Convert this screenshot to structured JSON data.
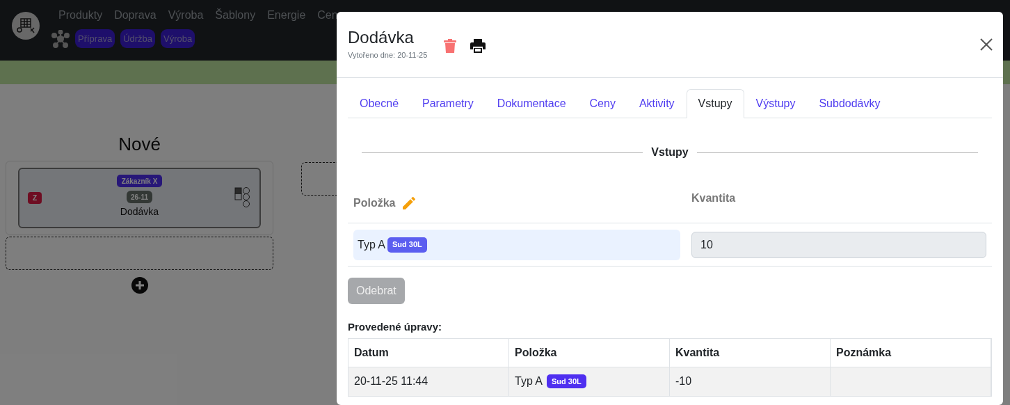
{
  "navbar": {
    "menu": [
      "Produkty",
      "Doprava",
      "Výroba",
      "Šablony",
      "Energie",
      "Cen"
    ],
    "tags": [
      "Příprava",
      "Údržba",
      "Výroba"
    ]
  },
  "board": {
    "columns": [
      {
        "title": "Nové",
        "cards": [
          {
            "badge": "Z",
            "customer": "Zákazník X",
            "date": "26-11",
            "title": "Dodávka"
          }
        ]
      }
    ]
  },
  "modal": {
    "title": "Dodávka",
    "created": "Vytořeno dne: 20-11-25",
    "tabs": [
      {
        "label": "Obecné",
        "selected": false
      },
      {
        "label": "Parametry",
        "selected": false
      },
      {
        "label": "Dokumentace",
        "selected": false
      },
      {
        "label": "Ceny",
        "selected": false
      },
      {
        "label": "Aktivity",
        "selected": false
      },
      {
        "label": "Vstupy",
        "selected": true
      },
      {
        "label": "Výstupy",
        "selected": false
      },
      {
        "label": "Subdodávky",
        "selected": false
      }
    ],
    "section_title": "Vstupy",
    "inputs": {
      "columns": [
        "Položka",
        "Kvantita"
      ],
      "rows": [
        {
          "item": "Typ A",
          "tag": "Sud 30L",
          "quantity": "10"
        }
      ]
    },
    "remove_button": {
      "label": "Odebrat",
      "disabled": true
    },
    "history": {
      "title": "Provedené úpravy:",
      "columns": [
        "Datum",
        "Položka",
        "Kvantita",
        "Poznámka"
      ],
      "rows": [
        {
          "date": "20-11-25 11:44",
          "item": "Typ A",
          "tag": "Sud 30L",
          "quantity": "-10"
        }
      ]
    }
  }
}
